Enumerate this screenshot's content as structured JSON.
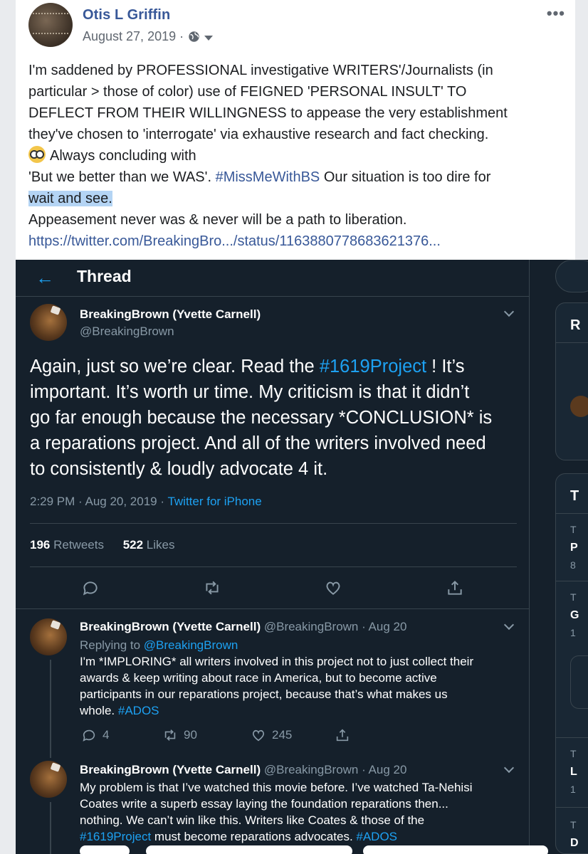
{
  "post": {
    "author": "Otis L Griffin",
    "date": "August 27, 2019 ·",
    "more": "•••",
    "avatar_text": "ve out\" specialist's pe / ibash the boomers' triflin / t you're doing in real-tim / ng documented #WEseeY",
    "text_lines": [
      "I'm saddened by PROFESSIONAL investigative WRITERS'/Journalists (in",
      "particular > those of color) use of FEIGNED 'PERSONAL INSULT' TO",
      "DEFLECT FROM THEIR WILLINGNESS to appease the very establishment",
      "they've chosen to 'interrogate' via exhaustive research and fact checking."
    ],
    "line5": "Always concluding with",
    "line6_a": "'But we better than we WAS'.",
    "line6_hashtag": "#MissMeWithBS",
    "line6_b": " Our situation is too dire for",
    "line7_selected": "wait and see.",
    "line8": "Appeasement never was & never will be a path to liberation.",
    "link": "https://twitter.com/BreakingBro.../status/1163880778683621376..."
  },
  "twitter": {
    "header_title": "Thread",
    "main_tweet": {
      "name": "BreakingBrown (Yvette Carnell)",
      "handle": "@BreakingBrown",
      "line1_a": "Again,  just so we’re clear. Read the ",
      "line1_tag": "#1619Project",
      "line1_b": " ! It’s",
      "lines": [
        "important. It’s worth ur time. My criticism is that it didn’t",
        "go far enough because the necessary *CONCLUSION* is",
        "a reparations project. And all of the writers involved need",
        "to consistently & loudly advocate 4 it."
      ],
      "time": "2:29 PM · Aug 20, 2019 · ",
      "source": "Twitter for iPhone",
      "retweets_count": "196",
      "retweets_label": " Retweets",
      "likes_count": "522",
      "likes_label": " Likes"
    },
    "reply1": {
      "name": "BreakingBrown (Yvette Carnell)",
      "handle_date": " @BreakingBrown · Aug 20",
      "replying_to": "Replying to ",
      "replying_handle": "@BreakingBrown",
      "lines": [
        "I'm *IMPLORING* all writers involved in this project not to just collect their",
        "awards & keep writing about race in America, but to become active",
        "participants in our reparations project, because that’s what makes us"
      ],
      "last_line_a": "whole. ",
      "last_line_tag": "#ADOS",
      "replies": "4",
      "retweets": "90",
      "likes": "245"
    },
    "reply2": {
      "name": "BreakingBrown (Yvette Carnell)",
      "handle_date": " @BreakingBrown · Aug 20",
      "lines": [
        "My problem is that I’ve watched this movie before. I’ve watched Ta-Nehisi",
        "Coates write a superb essay laying the foundation reparations then...",
        "nothing. We can’t win like this. Writers like Coates & those of the"
      ],
      "last_tag1": "#1619Project",
      "last_mid": " must become reparations advocates. ",
      "last_tag2": "#ADOS"
    },
    "right_column": {
      "letters": [
        "R",
        "T",
        "T",
        "P",
        "8",
        "T",
        "G",
        "1",
        "T",
        "L",
        "1",
        "T",
        "D"
      ]
    }
  }
}
